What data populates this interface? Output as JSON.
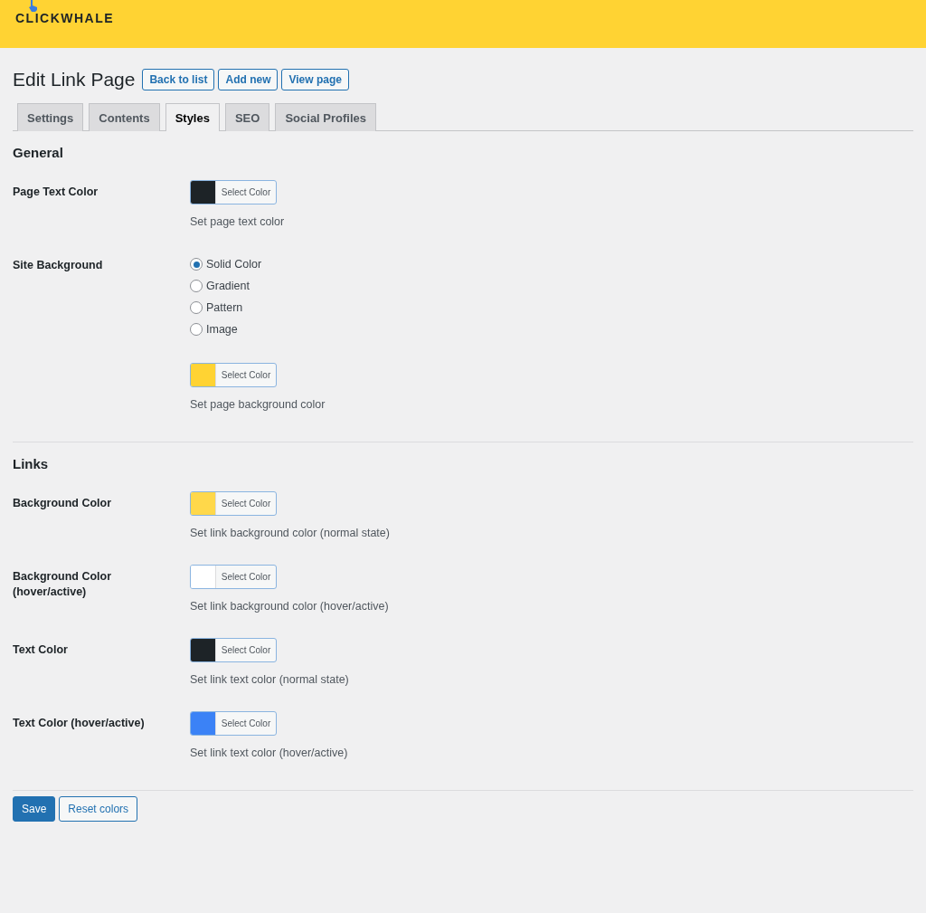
{
  "header": {
    "logo": "CLICKWHALE"
  },
  "page": {
    "title": "Edit Link Page",
    "actions": [
      "Back to list",
      "Add new",
      "View page"
    ]
  },
  "tabs": [
    {
      "label": "Settings",
      "selected": false
    },
    {
      "label": "Contents",
      "selected": false
    },
    {
      "label": "Styles",
      "selected": true
    },
    {
      "label": "SEO",
      "selected": false
    },
    {
      "label": "Social Profiles",
      "selected": false
    }
  ],
  "sections": [
    {
      "heading": "General",
      "rows": [
        {
          "kind": "color",
          "label": "Page Text Color",
          "button": "Select Color",
          "color": "#1d2327",
          "description": "Set page text color"
        },
        {
          "kind": "radio",
          "label": "Site Background",
          "options": [
            {
              "label": "Solid Color",
              "selected": true
            },
            {
              "label": "Gradient",
              "selected": false
            },
            {
              "label": "Pattern",
              "selected": false
            },
            {
              "label": "Image",
              "selected": false
            }
          ],
          "button": "Select Color",
          "color": "#ffd333",
          "description": "Set page background color"
        }
      ]
    },
    {
      "heading": "Links",
      "rows": [
        {
          "kind": "color",
          "label": "Background Color",
          "button": "Select Color",
          "color": "#ffd84a",
          "description": "Set link background color (normal state)"
        },
        {
          "kind": "color",
          "label": "Background Color (hover/active)",
          "button": "Select Color",
          "color": "#ffffff",
          "description": "Set link background color (hover/active)"
        },
        {
          "kind": "color",
          "label": "Text Color",
          "button": "Select Color",
          "color": "#1d2327",
          "description": "Set link text color (normal state)"
        },
        {
          "kind": "color",
          "label": "Text Color (hover/active)",
          "button": "Select Color",
          "color": "#3b82f6",
          "description": "Set link text color (hover/active)"
        }
      ]
    }
  ],
  "footer": {
    "save": "Save",
    "reset": "Reset colors"
  }
}
